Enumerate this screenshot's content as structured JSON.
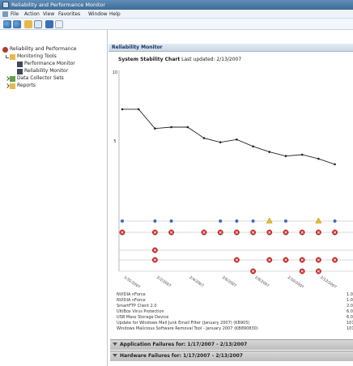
{
  "window": {
    "title": "Reliability and Performance Monitor"
  },
  "menu": [
    "File",
    "Action",
    "View",
    "Favorites",
    "Window",
    "Help"
  ],
  "toolbar": {
    "icons": [
      "back-arrow-icon",
      "forward-arrow-icon",
      "folder-up-icon",
      "show-hide-tree-icon",
      "help-icon",
      "properties-icon"
    ]
  },
  "tree": {
    "root": "Reliability and Performance",
    "monitoring_tools": "Monitoring Tools",
    "performance_monitor": "Performance Monitor",
    "reliability_monitor": "Reliability Monitor",
    "data_collector_sets": "Data Collector Sets",
    "reports": "Reports"
  },
  "pane": {
    "header": "Reliability Monitor",
    "chart_label": "System Stability Chart",
    "last_updated": "Last updated: 2/13/2007"
  },
  "chart_data": {
    "type": "line",
    "title": "System Stability Chart",
    "ylim": [
      0,
      10
    ],
    "y_ticks": [
      "10",
      "5"
    ],
    "x": [
      "1/31/2007",
      "2/1/2007",
      "2/2/2007",
      "2/3/2007",
      "2/4/2007",
      "2/5/2007",
      "2/6/2007",
      "2/7/2007",
      "2/8/2007",
      "2/9/2007",
      "2/10/2007",
      "2/11/2007",
      "2/12/2007",
      "2/13/2007"
    ],
    "x_tick_labels": [
      "1/31/2007",
      "2/2/2007",
      "2/4/2007",
      "2/6/2007",
      "2/8/2007",
      "2/10/2007",
      "2/12/2007"
    ],
    "series": [
      {
        "values": [
          7.3,
          7.3,
          5.9,
          6.0,
          6.0,
          5.2,
          4.9,
          5.1,
          4.6,
          4.2,
          3.9,
          4.0,
          3.7,
          3.3
        ]
      }
    ],
    "event_rows": {
      "warnings": [
        0,
        0,
        0,
        0,
        0,
        0,
        0,
        0,
        0,
        1,
        0,
        0,
        1,
        0
      ],
      "informational": [
        1,
        0,
        1,
        1,
        0,
        0,
        1,
        1,
        1,
        0,
        1,
        0,
        0,
        1
      ],
      "failures_row1": [
        1,
        0,
        1,
        1,
        0,
        1,
        1,
        1,
        1,
        1,
        1,
        1,
        1,
        1
      ],
      "failures_row2": [
        0,
        0,
        1,
        0,
        0,
        0,
        0,
        0,
        0,
        0,
        0,
        0,
        0,
        0
      ],
      "failures_row3": [
        0,
        0,
        1,
        0,
        0,
        0,
        0,
        1,
        0,
        1,
        1,
        1,
        1,
        1
      ],
      "failures_row4": [
        0,
        0,
        0,
        0,
        0,
        0,
        0,
        0,
        1,
        0,
        0,
        1,
        1,
        0
      ]
    },
    "colors": {
      "line": "#222222",
      "failure": "#d42a2a",
      "warning": "#e8c21a",
      "info": "#3a6cc0",
      "gridline": "#b5b5b5"
    }
  },
  "details": [
    {
      "name": "NVIDIA nForce",
      "value": "1.00"
    },
    {
      "name": "NVIDIA nForce",
      "value": "1.00"
    },
    {
      "name": "SmartFTP Client 2.0",
      "value": "2.0.1"
    },
    {
      "name": "UltiBox Virus Protection",
      "value": "6.0.1"
    },
    {
      "name": "USB Mass Storage Device",
      "value": "6.0.6"
    },
    {
      "name": "Update for Windows Mail Junk Email Filter (January 2007) (KB905)",
      "value": "101"
    },
    {
      "name": "Windows Malicious Software Removal Tool - January 2007 (KB890830)",
      "value": "101"
    }
  ],
  "bands": {
    "application": "Application Failures for: 1/17/2007 - 2/13/2007",
    "hardware": "Hardware Failures for: 1/17/2007 - 2/13/2007"
  }
}
